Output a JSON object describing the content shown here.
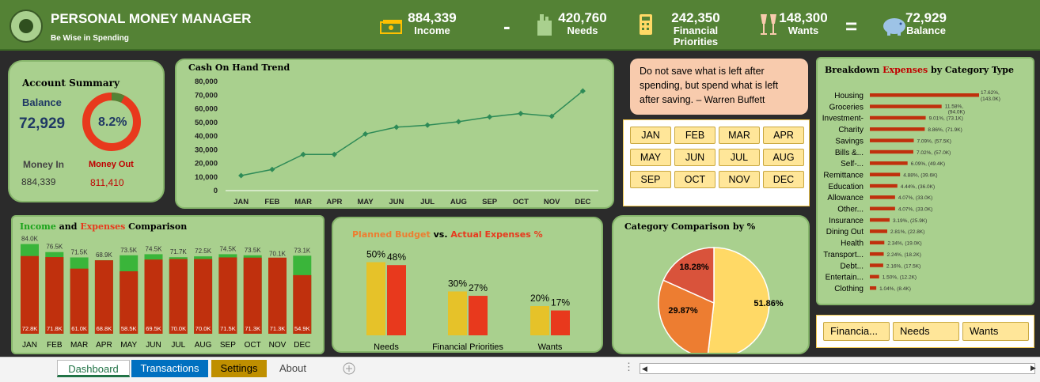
{
  "header": {
    "title": "PERSONAL MONEY MANAGER",
    "subtitle": "Be Wise in Spending",
    "income_value": "884,339",
    "income_label": "Income",
    "minus": "-",
    "needs_value": "420,760",
    "needs_label": "Needs",
    "fin_value": "242,350",
    "fin_label": "Financial Priorities",
    "wants_value": "148,300",
    "wants_label": "Wants",
    "equals": "=",
    "balance_value": "72,929",
    "balance_label": "Balance"
  },
  "account_summary": {
    "title": "Account Summary",
    "balance_label": "Balance",
    "balance_value": "72,929",
    "percent": "8.2%",
    "money_in_label": "Money In",
    "money_in_value": "884,339",
    "money_out_label": "Money Out",
    "money_out_value": "811,410"
  },
  "quote": {
    "text": "Do not save what is left after spending, but spend what is left after saving.",
    "author": "– Warren Buffett"
  },
  "months": [
    "JAN",
    "FEB",
    "MAR",
    "APR",
    "MAY",
    "JUN",
    "JUL",
    "AUG",
    "SEP",
    "OCT",
    "NOV",
    "DEC"
  ],
  "type_slicer": [
    "Financia...",
    "Needs",
    "Wants"
  ],
  "tabs": {
    "dashboard": "Dashboard",
    "transactions": "Transactions",
    "settings": "Settings",
    "about": "About"
  },
  "colors": {
    "header_green": "#548235",
    "panel_green": "#a9d08e",
    "red": "#c0300d",
    "green_bar": "#3ab53a",
    "yellow": "#e6c229"
  },
  "chart_data": [
    {
      "type": "line",
      "title": "Cash On Hand Trend",
      "x": [
        "JAN",
        "FEB",
        "MAR",
        "APR",
        "MAY",
        "JUN",
        "JUL",
        "AUG",
        "SEP",
        "OCT",
        "NOV",
        "DEC"
      ],
      "y": [
        11000,
        15500,
        26500,
        26500,
        41500,
        46500,
        48000,
        50500,
        54000,
        56500,
        54500,
        73000
      ],
      "ylim": [
        0,
        80000
      ],
      "yticks": [
        "80,000",
        "70,000",
        "60,000",
        "50,000",
        "40,000",
        "30,000",
        "20,000",
        "10,000",
        "0"
      ]
    },
    {
      "type": "bar",
      "title_parts": [
        "Income",
        " and ",
        "Expenses",
        " Comparison"
      ],
      "categories": [
        "JAN",
        "FEB",
        "MAR",
        "APR",
        "MAY",
        "JUN",
        "JUL",
        "AUG",
        "SEP",
        "OCT",
        "NOV",
        "DEC"
      ],
      "income": [
        84.0,
        76.5,
        71.5,
        68.9,
        73.5,
        74.5,
        71.7,
        72.5,
        74.5,
        73.5,
        70.1,
        73.1
      ],
      "expenses": [
        72.8,
        71.8,
        61.0,
        68.8,
        58.5,
        69.5,
        70.0,
        70.0,
        71.5,
        71.3,
        71.3,
        54.9
      ],
      "income_labels": [
        "84.0K",
        "76.5K",
        "71.5K",
        "68.9K",
        "73.5K",
        "74.5K",
        "71.7K",
        "72.5K",
        "74.5K",
        "73.5K",
        "70.1K",
        "73.1K"
      ],
      "expense_labels": [
        "72.8K",
        "71.8K",
        "61.0K",
        "68.8K",
        "58.5K",
        "69.5K",
        "70.0K",
        "70.0K",
        "71.5K",
        "71.3K",
        "71.3K",
        "54.9K"
      ]
    },
    {
      "type": "bar",
      "title_parts": [
        "Planned Budget",
        " vs. ",
        "Actual Expenses %"
      ],
      "categories": [
        "Needs",
        "Financial Priorities",
        "Wants"
      ],
      "planned": [
        50,
        30,
        20
      ],
      "actual": [
        48,
        27,
        17
      ],
      "planned_labels": [
        "50%",
        "30%",
        "20%"
      ],
      "actual_labels": [
        "48%",
        "27%",
        "17%"
      ]
    },
    {
      "type": "pie",
      "title": "Category Comparison by %",
      "values": [
        51.86,
        29.87,
        18.28
      ],
      "labels": [
        "51.86%",
        "29.87%",
        "18.28%"
      ],
      "colors": [
        "#ffd966",
        "#ed7d31",
        "#d9533b"
      ]
    },
    {
      "type": "bar",
      "title_parts": [
        "Breakdown ",
        "Expenses",
        " by Category Type"
      ],
      "categories": [
        "Housing",
        "Groceries",
        "Investment-",
        "Charity",
        "Savings",
        "Bills &...",
        "Self-...",
        "Remittance",
        "Education",
        "Allowance",
        "Other...",
        "Insurance",
        "Dining Out",
        "Health",
        "Transport...",
        "Debt...",
        "Entertain...",
        "Clothing"
      ],
      "values": [
        17.62,
        11.58,
        9.01,
        8.86,
        7.09,
        7.02,
        6.09,
        4.88,
        4.44,
        4.07,
        4.07,
        3.19,
        2.81,
        2.34,
        2.24,
        2.16,
        1.5,
        1.04
      ],
      "labels": [
        "17.62%, (143.0K)",
        "11.58%, (94.0K)",
        "9.01%, (73.1K)",
        "8.86%, (71.9K)",
        "7.09%, (57.5K)",
        "7.02%, (57.0K)",
        "6.09%, (49.4K)",
        "4.88%, (39.6K)",
        "4.44%, (36.0K)",
        "4.07%, (33.0K)",
        "4.07%, (33.0K)",
        "3.19%, (25.9K)",
        "2.81%, (22.8K)",
        "2.34%, (19.0K)",
        "2.24%, (18.2K)",
        "2.16%, (17.5K)",
        "1.50%, (12.2K)",
        "1.04%, (8.4K)"
      ]
    }
  ]
}
